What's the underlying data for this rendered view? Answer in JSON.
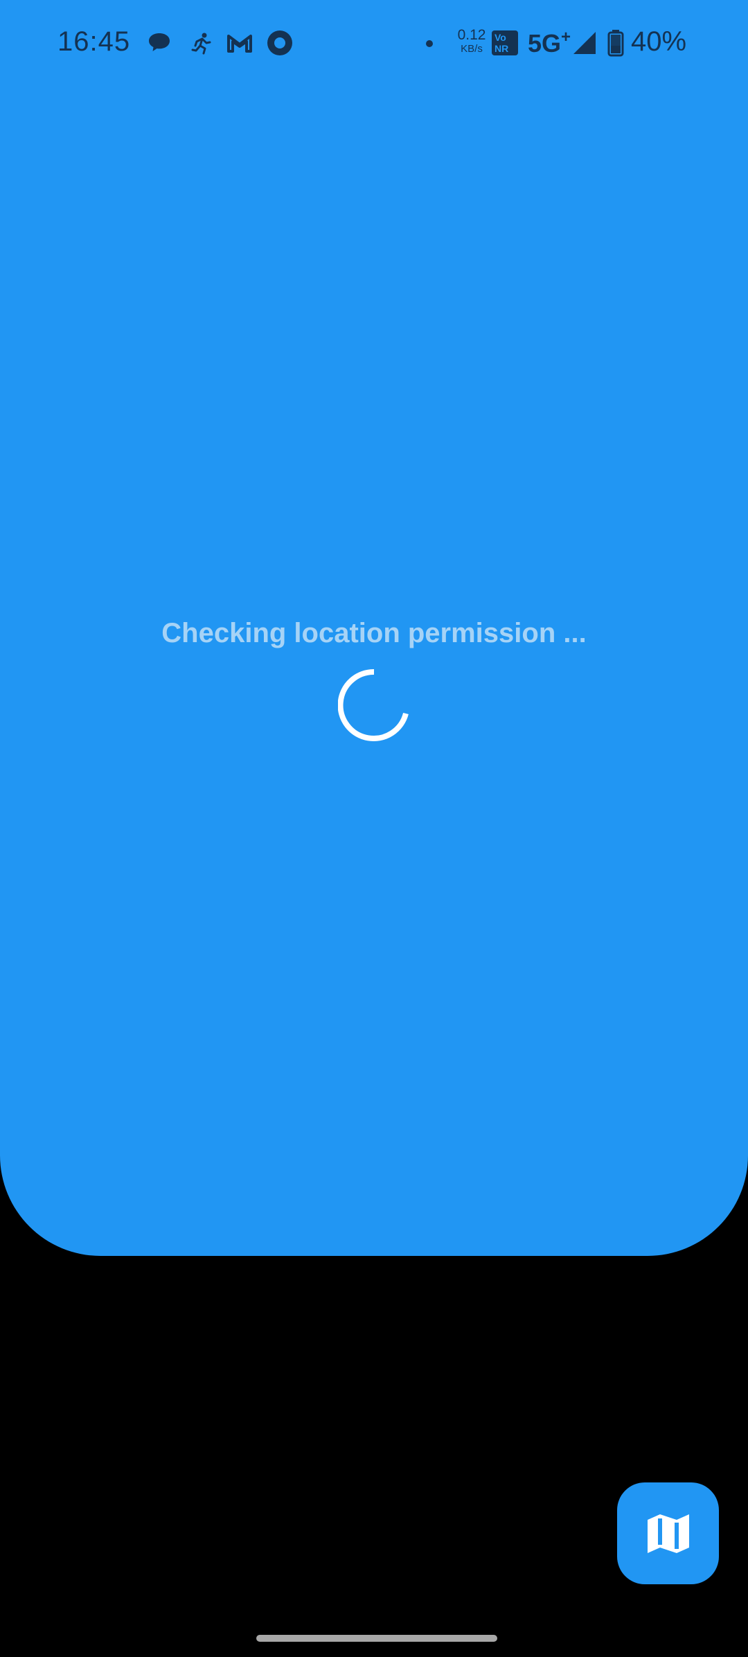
{
  "status_bar": {
    "time": "16:45",
    "notification_icons": [
      "chat-bubble-icon",
      "running-figure-icon",
      "gmail-icon",
      "ring-app-icon"
    ],
    "data_speed_value": "0.12",
    "data_speed_unit": "KB/s",
    "vonr_top": "Vo",
    "vonr_bottom": "NR",
    "network": "5G",
    "network_sup": "+",
    "battery_percent": "40%"
  },
  "main": {
    "loading_text": "Checking location permission ...",
    "accent_color": "#2196F3"
  },
  "fab": {
    "icon": "map-icon"
  }
}
